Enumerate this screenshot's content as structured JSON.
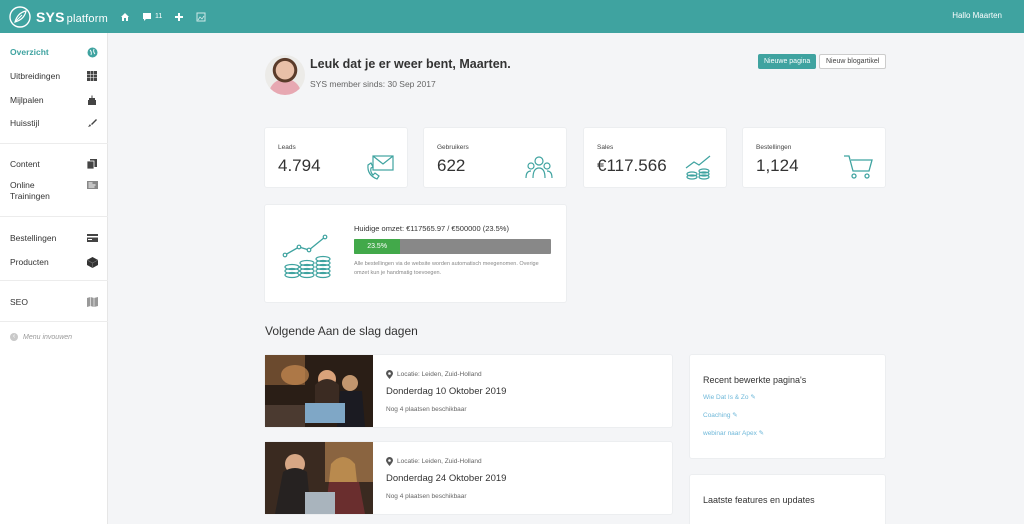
{
  "app": {
    "brand_main": "SYS",
    "brand_sub": "platform",
    "messages_count": "11",
    "greeting": "Hallo Maarten",
    "accent": "#3fa3a0"
  },
  "sidebar": {
    "items": [
      {
        "label": "Overzicht",
        "icon": "globe-icon"
      },
      {
        "label": "Uitbreidingen",
        "icon": "grid-icon"
      },
      {
        "label": "Mijlpalen",
        "icon": "cake-icon"
      },
      {
        "label": "Huisstijl",
        "icon": "brush-icon"
      },
      {
        "label": "Content",
        "icon": "copy-icon"
      },
      {
        "label": "Online Trainingen",
        "icon": "training-icon"
      },
      {
        "label": "Bestellingen",
        "icon": "card-icon"
      },
      {
        "label": "Producten",
        "icon": "box-icon"
      },
      {
        "label": "SEO",
        "icon": "map-icon"
      }
    ],
    "collapse_label": "Menu invouwen"
  },
  "header": {
    "welcome": "Leuk dat je er weer bent, Maarten.",
    "member_since": "SYS member sinds: 30 Sep 2017",
    "btn_new_page": "Nieuwe pagina",
    "btn_new_post": "Nieuw blogartikel"
  },
  "stats": [
    {
      "label": "Leads",
      "value": "4.794",
      "icon": "mail-phone-icon"
    },
    {
      "label": "Gebruikers",
      "value": "622",
      "icon": "users-icon"
    },
    {
      "label": "Sales",
      "value": "€117.566",
      "icon": "sales-chart-icon"
    },
    {
      "label": "Bestellingen",
      "value": "1,124",
      "icon": "cart-icon"
    }
  ],
  "revenue": {
    "title": "Huidige omzet: €117565.97 / €500000 (23.5%)",
    "progress_label": "23.5%",
    "progress": 0.235,
    "note": "Alle bestellingen via de website worden automatisch meegenomen. Overige omzet kun je handmatig toevoegen."
  },
  "events_section": {
    "title": "Volgende Aan de slag dagen",
    "events": [
      {
        "location": "Locatie: Leiden, Zuid-Holland",
        "date": "Donderdag 10 Oktober 2019",
        "seats": "Nog 4 plaatsen beschikbaar"
      },
      {
        "location": "Locatie: Leiden, Zuid-Holland",
        "date": "Donderdag 24 Oktober 2019",
        "seats": "Nog 4 plaatsen beschikbaar"
      }
    ]
  },
  "recent_pages": {
    "title": "Recent bewerkte pagina's",
    "links": [
      "Wie Dat Is & Zo",
      "Coaching",
      "webinar naar Apex"
    ]
  },
  "features": {
    "title": "Laatste features en updates"
  }
}
